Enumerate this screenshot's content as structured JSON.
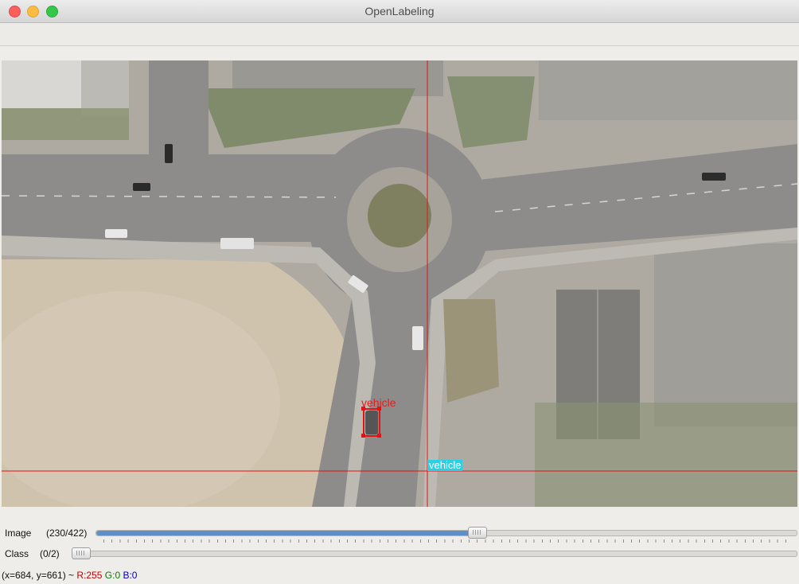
{
  "window": {
    "title": "OpenLabeling"
  },
  "canvas": {
    "bbox_label": "vehicle",
    "cursor_label": "vehicle"
  },
  "image_slider": {
    "label": "Image",
    "count": "(230/422)",
    "value": 230,
    "max": 422
  },
  "class_slider": {
    "label": "Class",
    "count": "(0/2)",
    "value": 0,
    "max": 2
  },
  "status": {
    "coords": "(x=684, y=661) ~",
    "r": "R:255",
    "g": "G:0",
    "b": "B:0"
  },
  "colors": {
    "crosshair": "#e01414",
    "bbox": "#e01414",
    "cursor_label_bg": "#27d2e6"
  }
}
